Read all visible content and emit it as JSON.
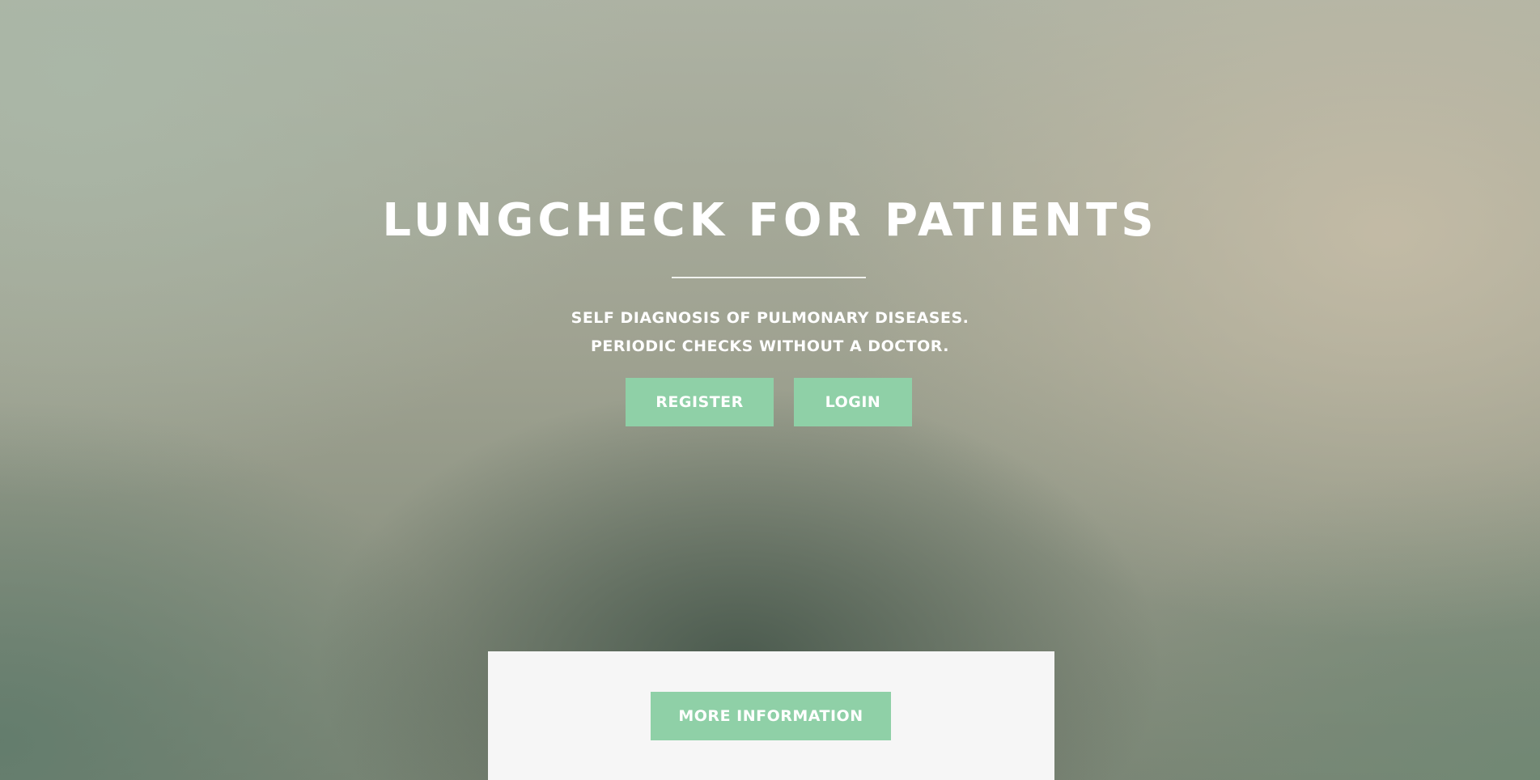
{
  "hero": {
    "title": "LUNGCHECK FOR PATIENTS",
    "subtitle_line1": "SELF DIAGNOSIS OF PULMONARY DISEASES.",
    "subtitle_line2": "PERIODIC CHECKS WITHOUT A DOCTOR.",
    "register_label": "REGISTER",
    "login_label": "LOGIN"
  },
  "info_panel": {
    "more_info_label": "MORE INFORMATION"
  },
  "colors": {
    "accent": "#8fd0a7",
    "text": "#ffffff",
    "panel": "#f6f6f6"
  }
}
